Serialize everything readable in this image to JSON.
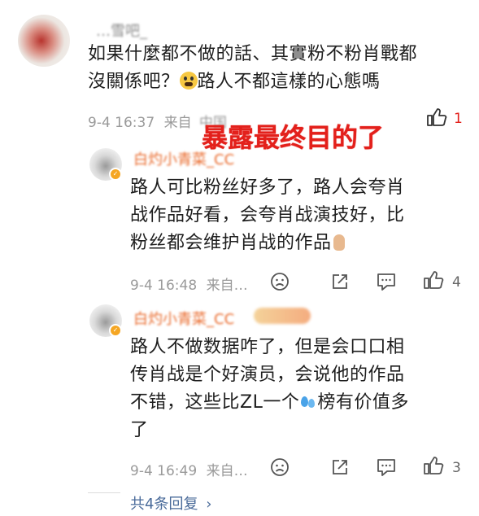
{
  "comment1": {
    "author": "…雪吧_",
    "line1": "如果什麼都不做的話、其實粉不粉肖戰都",
    "line2_a": "沒關係吧？",
    "line2_emoji": "fearful-face-emoji",
    "line2_b": "路人不都這樣的心態嗎",
    "time": "9-4 16:37",
    "source": "来自",
    "source_blur": "中国",
    "like_count": "1"
  },
  "annotation": "暴露最终目的了",
  "reply1": {
    "author": "白灼小青菜_CC",
    "text_lines": [
      "路人可比粉丝好多了，路人会夸肖",
      "战作品好看，会夸肖战演技好，比",
      "粉丝都会维护肖战的作品"
    ],
    "emoji": "ok-hand-emoji",
    "time": "9-4 16:48",
    "source": "来自…",
    "like_count": "4"
  },
  "reply2": {
    "author": "白灼小青菜_CC",
    "text_lines": [
      "路人不做数据咋了，但是会口口相",
      "传肖战是个好演员，会说他的作品",
      "不错，这些比ZL一个",
      "了"
    ],
    "line3_tail": "榜有价值多",
    "emoji": "sweat-droplets-emoji",
    "time": "9-4 16:49",
    "source": "来自…",
    "like_count": "3"
  },
  "more_replies": "共4条回复",
  "more_replies_chevron": "›",
  "colors": {
    "annotation_red": "#e3201b",
    "author_orange": "#e96a2c",
    "meta_gray": "#9a9a9a",
    "link_blue": "#4a6b9a"
  }
}
